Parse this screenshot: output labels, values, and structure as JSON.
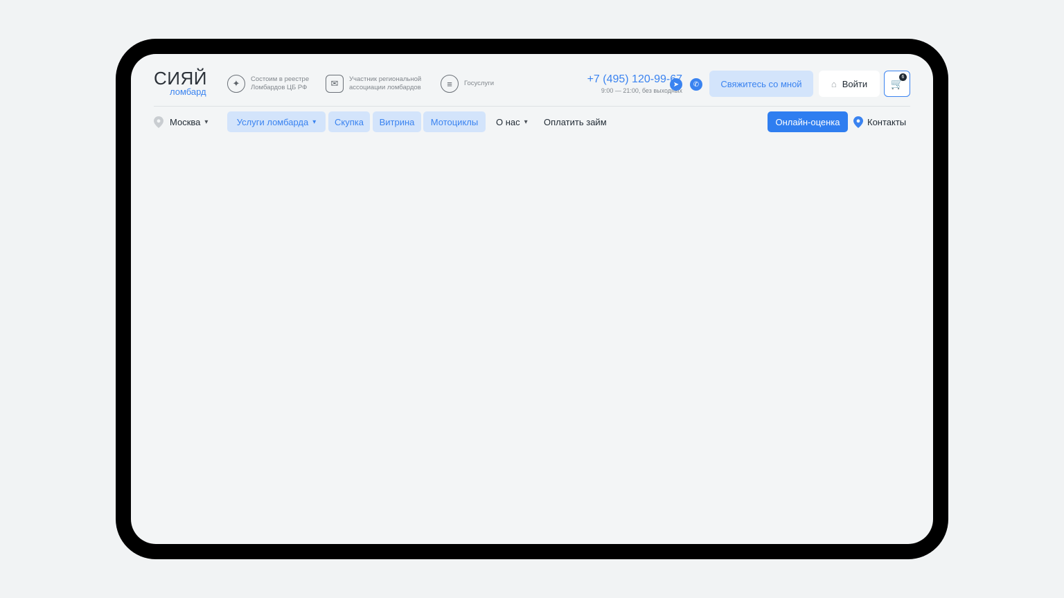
{
  "header": {
    "logo": {
      "main": "СИЯЙ",
      "sub": "ломбард"
    },
    "badges": [
      {
        "icon": "emblem-icon",
        "line1": "Состоим в реестре",
        "line2": "Ломбардов ЦБ РФ"
      },
      {
        "icon": "association-icon",
        "line1": "Участник региональной",
        "line2": "ассоциации ломбардов"
      },
      {
        "icon": "gosuslugi-icon",
        "line1": "Госуслуги",
        "line2": ""
      }
    ],
    "phone": "+7 (495) 120-99-67",
    "hours": "9:00 — 21:00, без выходных",
    "contact_button": "Свяжитесь со мной",
    "login_button": "Войти",
    "cart_count": "6"
  },
  "nav": {
    "city": "Москва",
    "items": [
      {
        "label": "Услуги ломбарда",
        "style": "pill",
        "dropdown": true
      },
      {
        "label": "Скупка",
        "style": "pill"
      },
      {
        "label": "Витрина",
        "style": "pill"
      },
      {
        "label": "Мотоциклы",
        "style": "pill"
      },
      {
        "label": "О нас",
        "style": "plain",
        "dropdown": true
      },
      {
        "label": "Оплатить займ",
        "style": "plain"
      }
    ],
    "online_button": "Онлайн-оценка",
    "contacts": "Контакты"
  },
  "colors": {
    "accent": "#3a83f0",
    "accent_soft": "#d3e4fb",
    "frame": "#000000",
    "screen": "#f3f5f6"
  }
}
